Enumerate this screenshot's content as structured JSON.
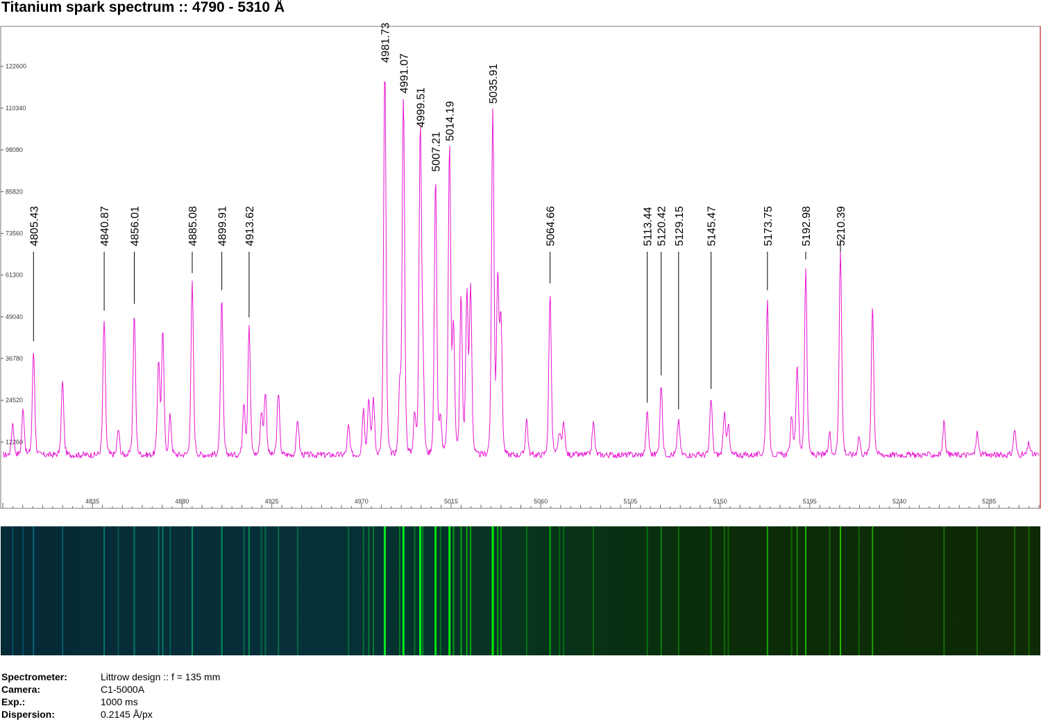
{
  "title": "Titanium spark spectrum :: 4790 - 5310 Å",
  "colors": {
    "spectrum_line": "#e815d2",
    "plot_border_left": "#7a7a7a",
    "plot_border_right": "#d04a4a",
    "label_leader": "#000000",
    "strip_background_left": "#062a36",
    "strip_background_right": "#0d2a06"
  },
  "chart_data": {
    "type": "line",
    "title": "Titanium spark spectrum :: 4790 - 5310 Å",
    "xlabel": "",
    "ylabel": "",
    "xlim": [
      4790,
      5310
    ],
    "ylim": [
      0,
      135000
    ],
    "grid": false,
    "x_ticks": [
      4835,
      4880,
      4925,
      4970,
      5015,
      5060,
      5105,
      5150,
      5195,
      5240,
      5285
    ],
    "y_ticks": [
      12260,
      24520,
      36780,
      49040,
      61300,
      73560,
      85820,
      98080,
      110340,
      122600
    ],
    "baseline": 8500,
    "peaks": [
      {
        "x": 4795.0,
        "y": 18000
      },
      {
        "x": 4800.2,
        "y": 22000
      },
      {
        "x": 4805.43,
        "y": 39000
      },
      {
        "x": 4820.0,
        "y": 30000
      },
      {
        "x": 4840.87,
        "y": 48000
      },
      {
        "x": 4848.0,
        "y": 16000
      },
      {
        "x": 4856.01,
        "y": 50000
      },
      {
        "x": 4868.2,
        "y": 36000
      },
      {
        "x": 4870.3,
        "y": 44000
      },
      {
        "x": 4874.0,
        "y": 20000
      },
      {
        "x": 4885.08,
        "y": 59000
      },
      {
        "x": 4899.91,
        "y": 54000
      },
      {
        "x": 4911.0,
        "y": 24000
      },
      {
        "x": 4913.62,
        "y": 46000
      },
      {
        "x": 4919.8,
        "y": 21000
      },
      {
        "x": 4921.8,
        "y": 27000
      },
      {
        "x": 4928.3,
        "y": 27000
      },
      {
        "x": 4938.0,
        "y": 19000
      },
      {
        "x": 4963.5,
        "y": 17000
      },
      {
        "x": 4971.0,
        "y": 22000
      },
      {
        "x": 4973.7,
        "y": 25000
      },
      {
        "x": 4976.0,
        "y": 25000
      },
      {
        "x": 4981.73,
        "y": 122000
      },
      {
        "x": 4989.2,
        "y": 27000
      },
      {
        "x": 4991.07,
        "y": 113000
      },
      {
        "x": 4996.7,
        "y": 20000
      },
      {
        "x": 4999.51,
        "y": 103000
      },
      {
        "x": 5000.8,
        "y": 34000
      },
      {
        "x": 5007.21,
        "y": 90000
      },
      {
        "x": 5009.7,
        "y": 19000
      },
      {
        "x": 5014.19,
        "y": 99000
      },
      {
        "x": 5016.2,
        "y": 46000
      },
      {
        "x": 5020.0,
        "y": 55000
      },
      {
        "x": 5022.9,
        "y": 55000
      },
      {
        "x": 5024.8,
        "y": 57000
      },
      {
        "x": 5035.91,
        "y": 110000
      },
      {
        "x": 5038.4,
        "y": 59000
      },
      {
        "x": 5040.0,
        "y": 48000
      },
      {
        "x": 5052.9,
        "y": 19000
      },
      {
        "x": 5064.66,
        "y": 56000
      },
      {
        "x": 5069.4,
        "y": 15000
      },
      {
        "x": 5071.5,
        "y": 18000
      },
      {
        "x": 5086.4,
        "y": 18000
      },
      {
        "x": 5113.44,
        "y": 21000
      },
      {
        "x": 5120.42,
        "y": 29000
      },
      {
        "x": 5129.15,
        "y": 19000
      },
      {
        "x": 5145.47,
        "y": 25000
      },
      {
        "x": 5152.2,
        "y": 20000
      },
      {
        "x": 5154.1,
        "y": 17000
      },
      {
        "x": 5173.75,
        "y": 54000
      },
      {
        "x": 5185.9,
        "y": 20000
      },
      {
        "x": 5188.7,
        "y": 35000
      },
      {
        "x": 5192.98,
        "y": 63000
      },
      {
        "x": 5205.0,
        "y": 15000
      },
      {
        "x": 5210.39,
        "y": 69000
      },
      {
        "x": 5219.7,
        "y": 14000
      },
      {
        "x": 5226.5,
        "y": 52000
      },
      {
        "x": 5262.4,
        "y": 18000
      },
      {
        "x": 5279.0,
        "y": 15000
      },
      {
        "x": 5297.8,
        "y": 16000
      },
      {
        "x": 5305.0,
        "y": 12000
      }
    ],
    "labeled_lines": [
      "4805.43",
      "4840.87",
      "4856.01",
      "4885.08",
      "4899.91",
      "4913.62",
      "4981.73",
      "4991.07",
      "4999.51",
      "5007.21",
      "5014.19",
      "5035.91",
      "5064.66",
      "5113.44",
      "5120.42",
      "5129.15",
      "5145.47",
      "5173.75",
      "5192.98",
      "5210.39"
    ]
  },
  "info": [
    {
      "key": "Spectrometer:",
      "value": "Littrow design :: f = 135 mm"
    },
    {
      "key": "Camera:",
      "value": "C1-5000A"
    },
    {
      "key": "Exp.:",
      "value": "1000 ms"
    },
    {
      "key": "Dispersion:",
      "value": "0.2145 Å/px"
    }
  ]
}
